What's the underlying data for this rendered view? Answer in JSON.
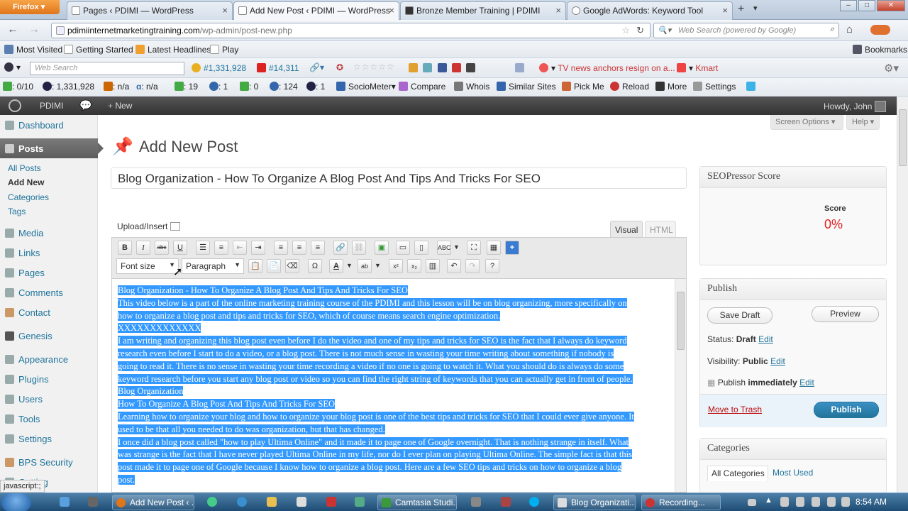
{
  "browser": {
    "menu_label": "Firefox",
    "tabs": [
      {
        "label": "Pages ‹ PDIMI — WordPress"
      },
      {
        "label": "Add New Post ‹ PDIMI — WordPress"
      },
      {
        "label": "Bronze Member Training | PDIMI"
      },
      {
        "label": "Google AdWords: Keyword Tool"
      }
    ],
    "url_host": "pdimiinternetmarketingtraining.com",
    "url_path": "/wp-admin/post-new.php",
    "search_placeholder": "Web Search (powered by Google)"
  },
  "bookmarks": {
    "items": [
      "Most Visited",
      "Getting Started",
      "Latest Headlines",
      "Play"
    ],
    "right_label": "Bookmarks"
  },
  "toolbar2": {
    "search_placeholder": "Web Search",
    "rank1": "#1,331,928",
    "rank2": "#14,311",
    "news": "TV news anchors resign on a...",
    "kmart": "Kmart"
  },
  "toolbar3": {
    "pr": ": 0/10",
    "alexa": ": 1,331,928",
    "n1": ": n/a",
    "n2": ": n/a",
    "g19": ": 19",
    "b1": ": 1",
    "g0": ": 0",
    "b124": ": 124",
    "i1": ": 1",
    "items": [
      "SocioMeter",
      "Compare",
      "Whois",
      "Similar Sites",
      "Pick Me",
      "Reload",
      "More",
      "Settings"
    ]
  },
  "wpbar": {
    "site": "PDIMI",
    "new": "New",
    "howdy": "Howdy, John"
  },
  "sidebar": {
    "dashboard": "Dashboard",
    "posts": "Posts",
    "subs": [
      "All Posts",
      "Add New",
      "Categories",
      "Tags"
    ],
    "menus": [
      "Media",
      "Links",
      "Pages",
      "Comments",
      "Contact",
      "Genesis",
      "Appearance",
      "Plugins",
      "Users",
      "Tools",
      "Settings",
      "BPS Security",
      "Getting"
    ]
  },
  "main": {
    "page_title": "Add New Post",
    "screen_options": "Screen Options",
    "help": "Help",
    "post_title": "Blog Organization - How To Organize A Blog Post And Tips And Tricks For SEO",
    "upload_insert": "Upload/Insert",
    "tab_visual": "Visual",
    "tab_html": "HTML",
    "font_size": "Font size",
    "paragraph": "Paragraph",
    "content": [
      "Blog Organization - How To Organize A Blog Post And Tips And Tricks For SEO",
      "This video below is a part of the online marketing training course of the PDIMI and this lesson will be on blog organizing, more specifically on",
      "how to organize a blog post and tips and tricks for SEO, which of course means search engine optimization.",
      "XXXXXXXXXXXXX",
      "I am writing and organizing this blog post even before I do the video and one of my tips and tricks for SEO is the fact that I always do keyword",
      "research even before I start to do a video, or a blog post. There is not much sense in wasting your time writing about something if nobody is",
      "going to read it. There is no sense in wasting your time recording a video if no one is going to watch it. What you should do is always do some",
      "keyword research before you start any blog post or video so you can find the right string of keywords that you can actually get in front of people.",
      "Blog Organization",
      "How To Organize A Blog Post And Tips And Tricks For SEO",
      "Learning how to organize your blog and how to organize your blog post is one of the best tips and tricks for SEO that I could ever give anyone. It",
      "used to be that all you needed to do was organization, but that has changed.",
      "I once did a blog post called \"how to play Ultima Online\" and it made it to page one of Google overnight. That is nothing strange in itself. What",
      "was strange is the fact that I have never played Ultima Online in my life, nor do I ever plan on playing Ultima Online. The simple fact is that this",
      "post made it to page one of Google because I know how to organize a blog post. Here are a few SEO tips and tricks on how to organize a blog",
      "post."
    ]
  },
  "seopressor": {
    "title": "SEOPressor Score",
    "score_label": "Score",
    "score": "0%"
  },
  "publish": {
    "title": "Publish",
    "save_draft": "Save Draft",
    "preview": "Preview",
    "status_label": "Status:",
    "status": "Draft",
    "visibility_label": "Visibility:",
    "visibility": "Public",
    "publish_label": "Publish",
    "publish_when": "immediately",
    "edit": "Edit",
    "trash": "Move to Trash",
    "publish_btn": "Publish"
  },
  "categories": {
    "title": "Categories",
    "tab_all": "All Categories",
    "tab_used": "Most Used"
  },
  "status_bar": "javascript:;",
  "taskbar": {
    "tasks": [
      "Add New Post ‹ ...",
      "Camtasia Studi...",
      "Blog Organizati...",
      "Recording..."
    ],
    "clock": "8:54 AM"
  },
  "colors": {
    "link": "#21759b",
    "selection": "#3399ff",
    "score_red": "#e02020",
    "trash_red": "#bc0b0b"
  }
}
